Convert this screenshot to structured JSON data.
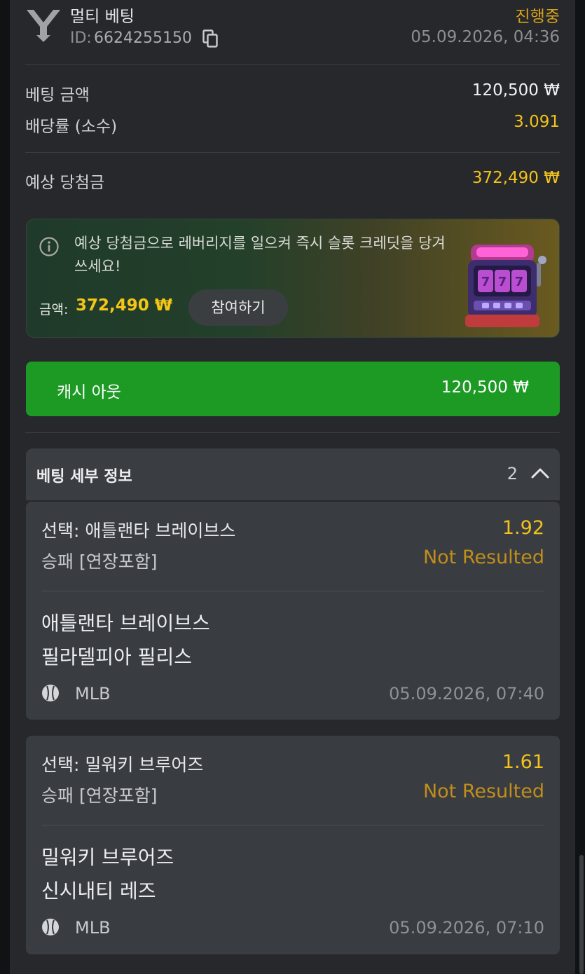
{
  "header": {
    "bet_type": "멀티 베팅",
    "id_label": "ID:",
    "bet_id": "6624255150",
    "status": "진행중",
    "datetime": "05.09.2026, 04:36"
  },
  "summary": {
    "stake_label": "베팅 금액",
    "stake_value": "120,500 ₩",
    "odds_label": "배당률 (소수)",
    "odds_value": "3.091",
    "payout_label": "예상 당첨금",
    "payout_value": "372,490 ₩"
  },
  "promo": {
    "text": "예상 당첨금으로 레버리지를 일으켜 즉시 슬롯 크레딧을 당겨 쓰세요!",
    "amount_label": "금액:",
    "amount": "372,490 ₩",
    "join_label": "참여하기"
  },
  "cashout": {
    "label": "캐시 아웃",
    "amount": "120,500 ₩"
  },
  "details": {
    "title": "베팅 세부 정보",
    "count": "2"
  },
  "selections": [
    {
      "selection": "선택: 애틀랜타 브레이브스",
      "odds": "1.92",
      "market": "승패 [연장포함]",
      "result": "Not Resulted",
      "team1": "애틀랜타 브레이브스",
      "team2": "필라델피아 필리스",
      "league": "MLB",
      "time": "05.09.2026, 07:40"
    },
    {
      "selection": "선택: 밀워키 브루어즈",
      "odds": "1.61",
      "market": "승패 [연장포함]",
      "result": "Not Resulted",
      "team1": "밀워키 브루어즈",
      "team2": "신시내티 레즈",
      "league": "MLB",
      "time": "05.09.2026, 07:10"
    }
  ],
  "colors": {
    "accent_gold": "#f2c21b",
    "status_orange": "#d9a21b",
    "cashout_green": "#1c9a24",
    "background": "#26282c"
  },
  "icons": [
    "brand-y-icon",
    "copy-icon",
    "info-icon",
    "slot-machine-icon",
    "chevron-up-icon",
    "baseball-icon"
  ]
}
